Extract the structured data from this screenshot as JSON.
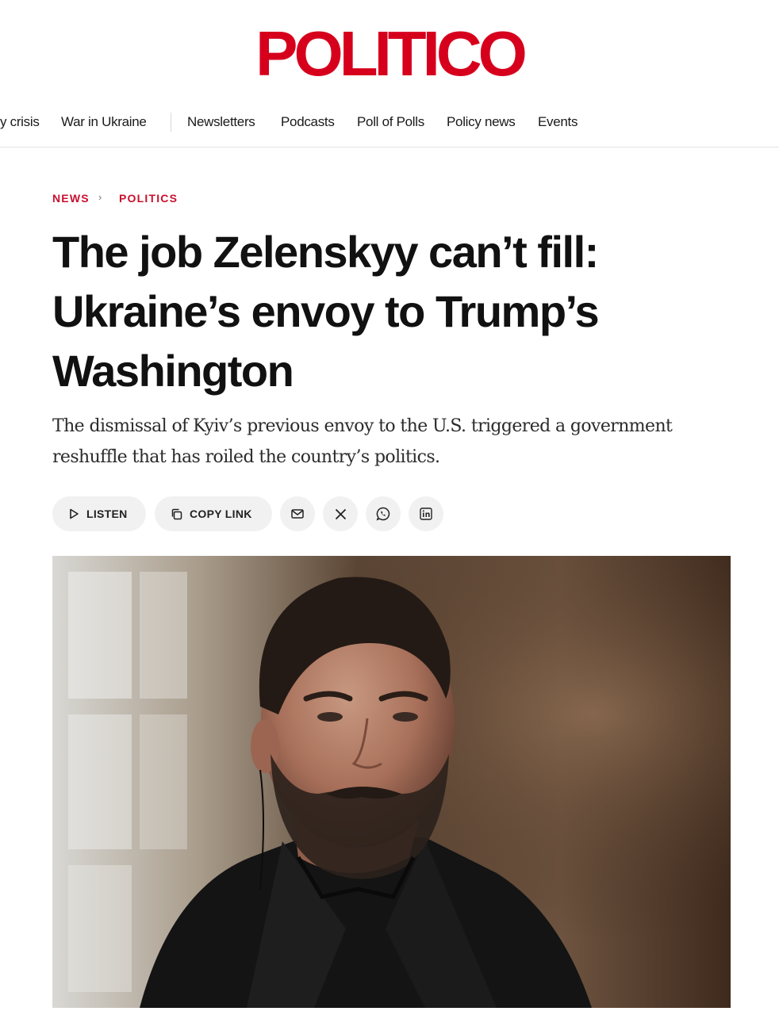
{
  "brand": {
    "logo": "POLITICO",
    "color": "#d6001c"
  },
  "nav": {
    "items": [
      {
        "label": "y crisis"
      },
      {
        "label": "War in Ukraine"
      },
      {
        "label": "Newsletters"
      },
      {
        "label": "Podcasts"
      },
      {
        "label": "Poll of Polls"
      },
      {
        "label": "Policy news"
      },
      {
        "label": "Events"
      }
    ]
  },
  "breadcrumb": {
    "section": "NEWS",
    "subsection": "POLITICS",
    "color": "#c8102e"
  },
  "article": {
    "headline": "The job Zelenskyy can’t fill: Ukraine’s envoy to Trump’s Washington",
    "dek": "The dismissal of Kyiv’s previous envoy to the U.S. triggered a government reshuffle that has roiled the country’s politics."
  },
  "actions": {
    "listen_label": "LISTEN",
    "listen_icon": "play-icon",
    "copy_label": "COPY LINK",
    "copy_icon": "copy-icon",
    "share_icons": [
      "email-icon",
      "x-icon",
      "whatsapp-icon",
      "linkedin-icon"
    ]
  },
  "hero_image": {
    "subject": "lead-photo"
  }
}
